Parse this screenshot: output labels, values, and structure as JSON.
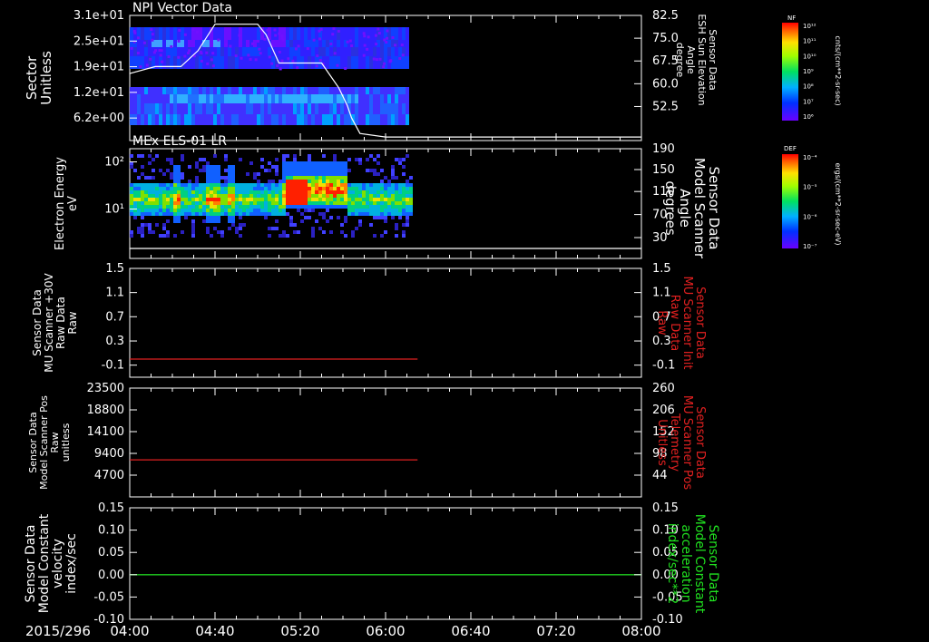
{
  "chart_data": [
    {
      "type": "heatmap",
      "title": "NPI Vector Data",
      "ylabel": [
        "Sector",
        "Unitless"
      ],
      "yticks": [
        "3.1e+01",
        "2.5e+01",
        "1.9e+01",
        "1.2e+01",
        "6.2e+00"
      ],
      "ylabel_right": [
        "Sensor Data",
        "ESH Sun Elevation",
        "Angle",
        "degree"
      ],
      "yticks_right": [
        "82.5",
        "75.0",
        "67.5",
        "60.0",
        "52.5"
      ],
      "ylim_right": [
        47.0,
        82.5
      ],
      "colorbar": {
        "name": "NF",
        "unit": "cnts/(cm**2-sr-sec)",
        "ticks": [
          "10¹²",
          "10¹¹",
          "10¹⁰",
          "10⁹",
          "10⁸",
          "10⁷",
          "10⁶"
        ]
      },
      "overlay_line": {
        "x": [
          "04:00",
          "04:12",
          "04:24",
          "04:32",
          "04:40",
          "05:00",
          "05:04",
          "05:10",
          "05:30",
          "05:34",
          "05:38",
          "05:42",
          "05:44",
          "05:48",
          "06:00",
          "08:00"
        ],
        "y": [
          66,
          68,
          68,
          72.5,
          80,
          80,
          77,
          69,
          69,
          65.5,
          62,
          57,
          53.5,
          49,
          48,
          48
        ]
      },
      "data_extent": [
        "04:00",
        "06:10"
      ]
    },
    {
      "type": "heatmap",
      "title": "MEx ELS-01 LR",
      "ylabel": [
        "Electron Energy",
        "eV"
      ],
      "yticks": [
        "10²",
        "10¹"
      ],
      "ylabel_right": [
        "Sensor Data",
        "Model Scanner",
        "Angle",
        "degrees"
      ],
      "yticks_right": [
        "190",
        "150",
        "110",
        "70",
        "30"
      ],
      "ylim_right": [
        10,
        190
      ],
      "colorbar": {
        "name": "DEF",
        "unit": "ergs/(cm**2-sr-sec-eV)",
        "ticks": [
          "10⁻⁴",
          "10⁻⁵",
          "10⁻⁶",
          "10⁻⁷"
        ]
      },
      "overlay_line": {
        "x": [
          "04:00",
          "08:00"
        ],
        "y": [
          20,
          20
        ]
      },
      "data_extent": [
        "04:00",
        "06:12"
      ]
    },
    {
      "type": "line",
      "ylabel": [
        "Sensor Data",
        "MU Scanner +30V",
        "Raw Data",
        "Raw"
      ],
      "yticks": [
        "1.5",
        "1.1",
        "0.7",
        "0.3",
        "-0.1"
      ],
      "ylim": [
        -0.3,
        1.5
      ],
      "ylabel_right": [
        "Sensor Data",
        "MU Scanner Init",
        "Raw Data",
        "Raw"
      ],
      "yticks_right": [
        "1.5",
        "1.1",
        "0.7",
        "0.3",
        "-0.1"
      ],
      "series": [
        {
          "color": "#e02020",
          "x": [
            "04:00",
            "06:15"
          ],
          "values": [
            0.0,
            0.0
          ]
        }
      ]
    },
    {
      "type": "line",
      "ylabel": [
        "Sensor Data",
        "Model Scanner Pos",
        "Raw",
        "unitless"
      ],
      "yticks": [
        "23500",
        "18800",
        "14100",
        "9400",
        "4700"
      ],
      "ylim": [
        0,
        23500
      ],
      "ylabel_right": [
        "Sensor Data",
        "MU Scanner Pos",
        "Telemetry",
        "Unitless"
      ],
      "yticks_right": [
        "260",
        "206",
        "152",
        "98",
        "44"
      ],
      "series": [
        {
          "color": "#e02020",
          "x": [
            "04:00",
            "06:15"
          ],
          "values": [
            8000,
            8000
          ]
        }
      ]
    },
    {
      "type": "line",
      "ylabel": [
        "Sensor Data",
        "Model Constant",
        "velocity",
        "index/sec"
      ],
      "yticks": [
        "0.15",
        "0.10",
        "0.05",
        "0.00",
        "-0.05",
        "-0.10"
      ],
      "ylim": [
        -0.1,
        0.15
      ],
      "ylabel_right": [
        "Sensor Data",
        "Model Constant",
        "acceleration",
        "index/sec**2"
      ],
      "yticks_right": [
        "0.15",
        "0.10",
        "0.05",
        "0.00",
        "-0.05",
        "-0.10"
      ],
      "series": [
        {
          "color": "#20d020",
          "x": [
            "04:00",
            "08:00"
          ],
          "values": [
            0.0,
            0.0
          ]
        }
      ]
    }
  ],
  "xaxis": {
    "date_label": "2015/296",
    "ticks": [
      "04:00",
      "04:40",
      "05:20",
      "06:00",
      "06:40",
      "07:20",
      "08:00"
    ]
  },
  "colors": {
    "right_label_red": "#e02020",
    "right_label_green": "#20e020"
  }
}
